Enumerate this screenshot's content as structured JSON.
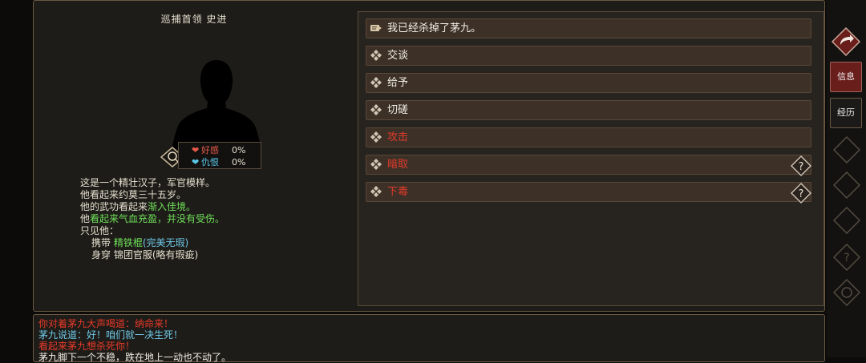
{
  "character": {
    "title": "巡捕首领 史进",
    "relations": [
      {
        "label": "好感",
        "value": "0%",
        "color": "#e85a4a"
      },
      {
        "label": "仇恨",
        "value": "0%",
        "color": "#5ac8e8"
      }
    ],
    "description": {
      "line1": "这是一个精壮汉子，军官模样。",
      "line2": "他看起来约莫三十五岁。",
      "line3_prefix": "他的武功看起来",
      "line3_highlight": "渐入佳境。",
      "line4_prefix": "他",
      "line4_highlight": "看起来气血充盈，并没有受伤。",
      "line5": "只见他：",
      "carry_label": "携带",
      "carry_item": "精铁棍",
      "carry_quality": "(完美无瑕)",
      "wear_label": "身穿",
      "wear_item": "锦团官服",
      "wear_quality": "(略有瑕疵)"
    }
  },
  "actions": [
    {
      "label": "我已经杀掉了茅九。",
      "icon": "quest-scroll-icon",
      "style": "normal",
      "help": false
    },
    {
      "label": "交谈",
      "icon": "diamond-bullet-icon",
      "style": "normal",
      "help": false
    },
    {
      "label": "给予",
      "icon": "diamond-bullet-icon",
      "style": "normal",
      "help": false
    },
    {
      "label": "切磋",
      "icon": "diamond-bullet-icon",
      "style": "normal",
      "help": false
    },
    {
      "label": "攻击",
      "icon": "diamond-bullet-icon",
      "style": "danger",
      "help": false
    },
    {
      "label": "暗取",
      "icon": "diamond-bullet-icon",
      "style": "danger",
      "help": true
    },
    {
      "label": "下毒",
      "icon": "diamond-bullet-icon",
      "style": "danger",
      "help": true
    }
  ],
  "help_mark": "?",
  "log": [
    {
      "text": "你对着茅九大声喝道：纳命来！",
      "color": "#e83a2a"
    },
    {
      "text": "茅九说道：好！咱们就一决生死！",
      "color": "#6ec8e8"
    },
    {
      "text": "看起来茅九想杀死你！",
      "color": "#e83a2a"
    },
    {
      "text": "茅九脚下一个不稳，跌在地上一动也不动了。",
      "color": "#f0ece4"
    }
  ],
  "sidebar": {
    "info_label": "信息",
    "history_label": "经历",
    "dim_icons": [
      "skill-icon",
      "study-icon",
      "sect-icon",
      "help-icon",
      "settings-icon"
    ]
  },
  "colors": {
    "accent_red": "#e23a2a",
    "accent_green": "#6fe05a",
    "accent_cyan": "#6ec8e8"
  }
}
